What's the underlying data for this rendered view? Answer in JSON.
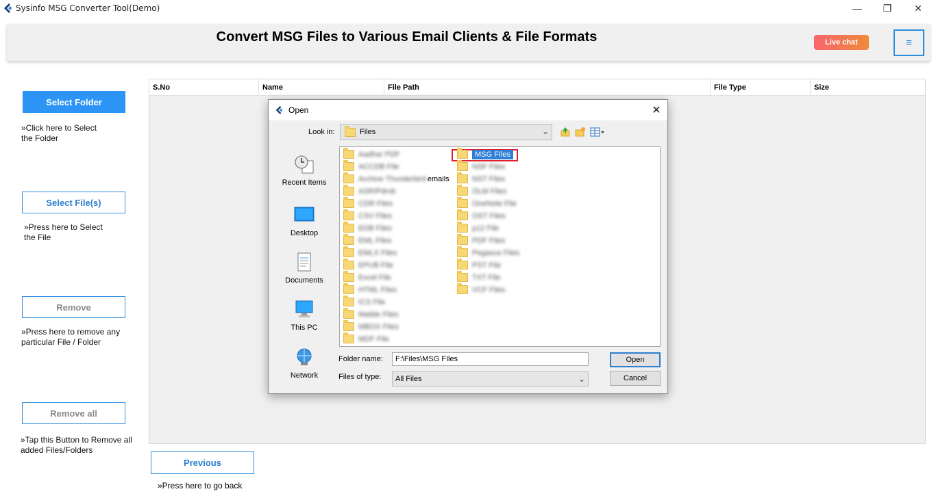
{
  "window": {
    "title": "Sysinfo MSG Converter Tool(Demo)",
    "minimize": "—",
    "restore": "❐",
    "close": "✕"
  },
  "header": {
    "title": "Convert MSG Files to Various Email Clients & File Formats",
    "live_chat": "Live chat",
    "menu_icon": "≡"
  },
  "sidebar": {
    "select_folder": {
      "label": "Select Folder",
      "hint": "»Click here to Select the Folder"
    },
    "select_files": {
      "label": "Select File(s)",
      "hint": "»Press here to Select the File"
    },
    "remove": {
      "label": "Remove",
      "hint": "»Press here to remove any particular File / Folder"
    },
    "remove_all": {
      "label": "Remove all",
      "hint": "»Tap this Button to Remove all added Files/Folders"
    }
  },
  "table": {
    "columns": [
      "S.No",
      "Name",
      "File Path",
      "File Type",
      "Size"
    ]
  },
  "footer": {
    "previous": "Previous",
    "previous_hint": "»Press here to go back"
  },
  "dialog": {
    "title": "Open",
    "close": "✕",
    "look_in_label": "Look in:",
    "look_in_value": "Files",
    "places": [
      "Recent Items",
      "Desktop",
      "Documents",
      "This PC",
      "Network"
    ],
    "folders_left": [
      "Aadhar PDF",
      "ACCDB File",
      "Archive Thunderbird",
      "ASR/Pdrvb",
      "CDR Files",
      "CSV Files",
      "EDB Files",
      "EML Files",
      "EMLX Files",
      "EPUB File",
      "Excel File",
      "HTML Files",
      "ICS File",
      "Mailde Files",
      "MBOX Files",
      "MDF File"
    ],
    "folders_left_suffix": "emails",
    "folders_right": [
      "MSG FIles",
      "NSF Files",
      "NST Files",
      "OLM Files",
      "OneNote File",
      "OST Files",
      "p12 File",
      "PDF Files",
      "Pegasus Files",
      "PST File",
      "TXT File",
      "VCF Files"
    ],
    "folder_name_label": "Folder name:",
    "folder_name_value": "F:\\Files\\MSG FIles",
    "files_of_type_label": "Files of type:",
    "files_of_type_value": "All Files",
    "open": "Open",
    "cancel": "Cancel"
  }
}
